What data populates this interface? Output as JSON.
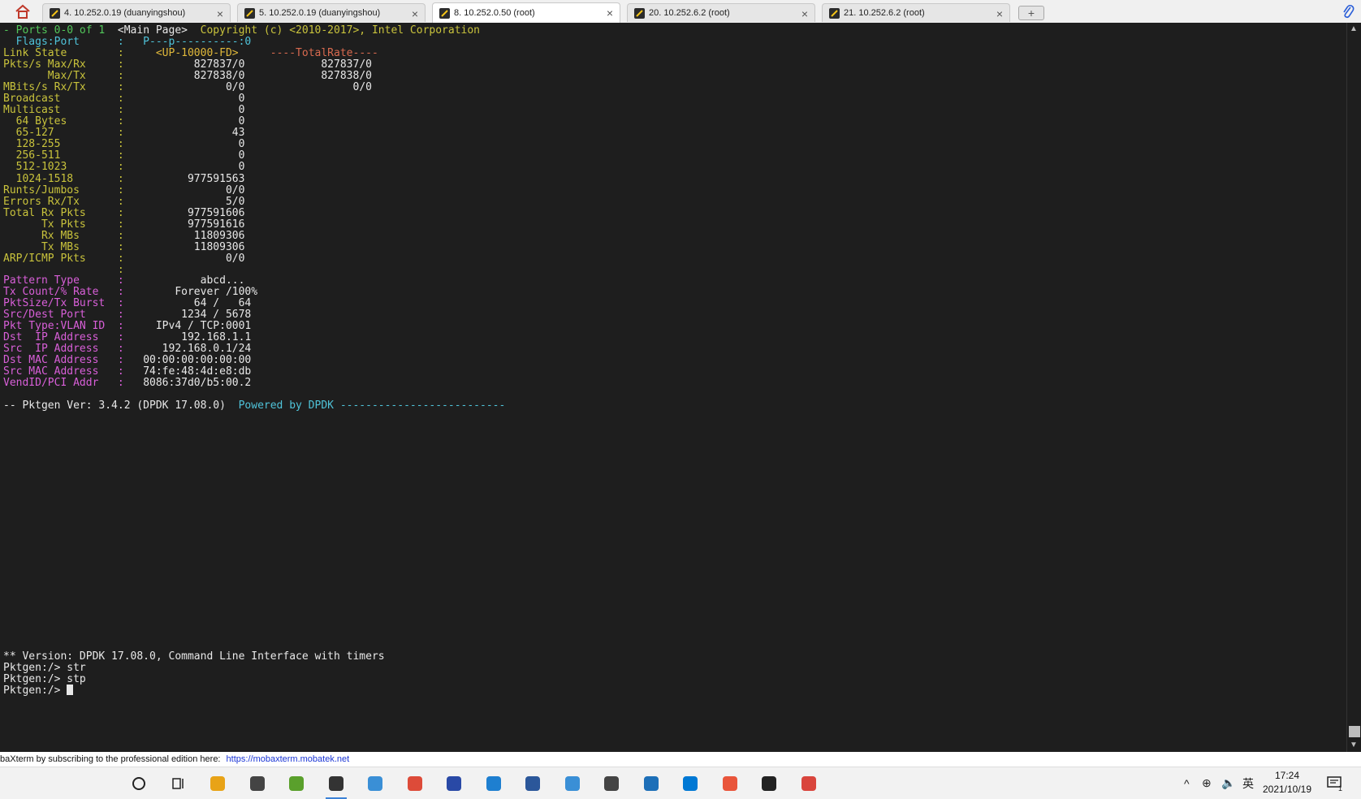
{
  "tabs": [
    {
      "label": "4. 10.252.0.19 (duanyingshou)",
      "active": false
    },
    {
      "label": "5. 10.252.0.19 (duanyingshou)",
      "active": false
    },
    {
      "label": "8. 10.252.0.50 (root)",
      "active": true
    },
    {
      "label": "20. 10.252.6.2 (root)",
      "active": false
    },
    {
      "label": "21. 10.252.6.2 (root)",
      "active": false
    }
  ],
  "tab_close": "×",
  "new_tab": "+",
  "terminal": {
    "header": {
      "ports": "- Ports 0-0 of 1",
      "main_page": "  <Main Page>  ",
      "copyright": "Copyright (c) <2010-2017>, Intel Corporation"
    },
    "flags_label": "  Flags:Port      :   P---p----------:0",
    "link_state": {
      "label": "Link State        :",
      "value": "     <UP-10000-FD>",
      "total": "     ----TotalRate----"
    },
    "stats": [
      {
        "label": "Pkts/s Max/Rx     :",
        "value": "           827837/0",
        "total": "            827837/0"
      },
      {
        "label": "       Max/Tx     :",
        "value": "           827838/0",
        "total": "            827838/0"
      },
      {
        "label": "MBits/s Rx/Tx     :",
        "value": "                0/0",
        "total": "                 0/0"
      },
      {
        "label": "Broadcast         :",
        "value": "                  0",
        "total": ""
      },
      {
        "label": "Multicast         :",
        "value": "                  0",
        "total": ""
      },
      {
        "label": "  64 Bytes        :",
        "value": "                  0",
        "total": ""
      },
      {
        "label": "  65-127          :",
        "value": "                 43",
        "total": ""
      },
      {
        "label": "  128-255         :",
        "value": "                  0",
        "total": ""
      },
      {
        "label": "  256-511         :",
        "value": "                  0",
        "total": ""
      },
      {
        "label": "  512-1023        :",
        "value": "                  0",
        "total": ""
      },
      {
        "label": "  1024-1518       :",
        "value": "          977591563",
        "total": ""
      },
      {
        "label": "Runts/Jumbos      :",
        "value": "                0/0",
        "total": ""
      },
      {
        "label": "Errors Rx/Tx      :",
        "value": "                5/0",
        "total": ""
      },
      {
        "label": "Total Rx Pkts     :",
        "value": "          977591606",
        "total": ""
      },
      {
        "label": "      Tx Pkts     :",
        "value": "          977591616",
        "total": ""
      },
      {
        "label": "      Rx MBs      :",
        "value": "           11809306",
        "total": ""
      },
      {
        "label": "      Tx MBs      :",
        "value": "           11809306",
        "total": ""
      },
      {
        "label": "ARP/ICMP Pkts     :",
        "value": "                0/0",
        "total": ""
      },
      {
        "label": "                  :",
        "value": "",
        "total": ""
      }
    ],
    "pattern": [
      {
        "label": "Pattern Type      :",
        "value": "            abcd..."
      },
      {
        "label": "Tx Count/% Rate   :",
        "value": "        Forever /100%"
      },
      {
        "label": "PktSize/Tx Burst  :",
        "value": "           64 /   64"
      },
      {
        "label": "Src/Dest Port     :",
        "value": "         1234 / 5678"
      },
      {
        "label": "Pkt Type:VLAN ID  :",
        "value": "     IPv4 / TCP:0001"
      },
      {
        "label": "Dst  IP Address   :",
        "value": "         192.168.1.1"
      },
      {
        "label": "Src  IP Address   :",
        "value": "      192.168.0.1/24"
      },
      {
        "label": "Dst MAC Address   :",
        "value": "   00:00:00:00:00:00"
      },
      {
        "label": "Src MAC Address   :",
        "value": "   74:fe:48:4d:e8:db"
      },
      {
        "label": "VendID/PCI Addr   :",
        "value": "   8086:37d0/b5:00.2"
      }
    ],
    "footer": {
      "version": "-- Pktgen Ver: 3.4.2 (DPDK 17.08.0)  ",
      "powered": "Powered by DPDK --------------------------"
    },
    "cli": {
      "banner": "** Version: DPDK 17.08.0, Command Line Interface with timers",
      "history": [
        "Pktgen:/> str",
        "Pktgen:/> stp"
      ],
      "prompt": "Pktgen:/> "
    }
  },
  "statusbar": {
    "text": "baXterm by subscribing to the professional edition here: ",
    "link": "https://mobaxterm.mobatek.net"
  },
  "taskbar": {
    "icons": [
      "cortana-icon",
      "task-view-icon",
      "file-explorer-icon",
      "mail-icon",
      "notepad-icon",
      "mobaxterm-icon",
      "browser-icon",
      "chrome-icon",
      "app-icon",
      "search-app-icon",
      "word-icon",
      "control-panel-icon",
      "settings-icon",
      "wireshark-icon",
      "vscode-icon",
      "git-icon",
      "typora-icon",
      "snipping-icon"
    ],
    "tray": {
      "chevron": "^",
      "network": "⊕",
      "volume": "🔈",
      "ime": "英"
    },
    "clock": {
      "time": "17:24",
      "date": "2021/10/19"
    },
    "notification_count": "1"
  }
}
